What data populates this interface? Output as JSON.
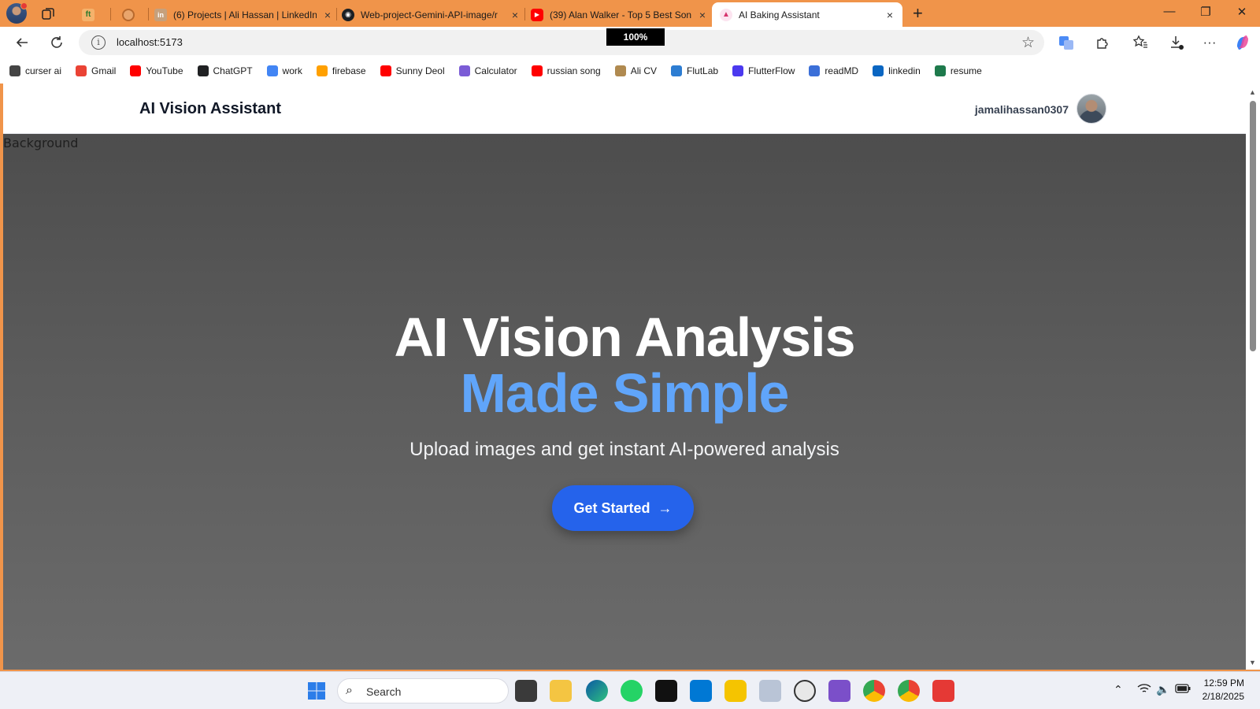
{
  "browser": {
    "tabs": [
      {
        "title": "",
        "pinned": true,
        "icon": "mirror-icon"
      },
      {
        "title": "",
        "pinned": true,
        "icon": "pinned-app-icon"
      },
      {
        "title": "(6) Projects | Ali Hassan | LinkedIn",
        "icon": "linkedin-icon"
      },
      {
        "title": "Web-project-Gemini-API-image/r",
        "icon": "github-icon"
      },
      {
        "title": "(39) Alan Walker - Top 5 Best Son",
        "icon": "youtube-icon"
      },
      {
        "title": "AI Baking Assistant",
        "icon": "app-favicon",
        "active": true
      }
    ],
    "tab_close": "×",
    "new_tab": "+",
    "url": "localhost:5173",
    "zoom_popup": "100%",
    "window_controls": {
      "minimize": "—",
      "restore": "❐",
      "close": "✕"
    }
  },
  "bookmarks": [
    {
      "label": "curser ai",
      "color": "#444444"
    },
    {
      "label": "Gmail",
      "color": "#ea4335"
    },
    {
      "label": "YouTube",
      "color": "#ff0000"
    },
    {
      "label": "ChatGPT",
      "color": "#202123"
    },
    {
      "label": "work",
      "color": "#4285f4"
    },
    {
      "label": "firebase",
      "color": "#ffa000"
    },
    {
      "label": "Sunny Deol",
      "color": "#ff0000"
    },
    {
      "label": "Calculator",
      "color": "#7b5cd6"
    },
    {
      "label": "russian song",
      "color": "#ff0000"
    },
    {
      "label": "Ali CV",
      "color": "#b08a50"
    },
    {
      "label": "FlutLab",
      "color": "#2d7dd2"
    },
    {
      "label": "FlutterFlow",
      "color": "#4b39ef"
    },
    {
      "label": "readMD",
      "color": "#3b6fd8"
    },
    {
      "label": "linkedin",
      "color": "#0a66c2"
    },
    {
      "label": "resume",
      "color": "#1e7a4c"
    }
  ],
  "app": {
    "brand": "AI Vision Assistant",
    "username": "jamalihassan0307",
    "background_alt": "Background",
    "hero": {
      "title_line1": "AI Vision Analysis",
      "title_line2": "Made Simple",
      "subtitle": "Upload images and get instant AI-powered analysis",
      "cta_label": "Get Started",
      "cta_arrow": "→"
    },
    "colors": {
      "accent": "#60a5fa",
      "button": "#2563eb"
    }
  },
  "taskbar": {
    "search_placeholder": "Search",
    "time": "12:59 PM",
    "date": "2/18/2025"
  }
}
